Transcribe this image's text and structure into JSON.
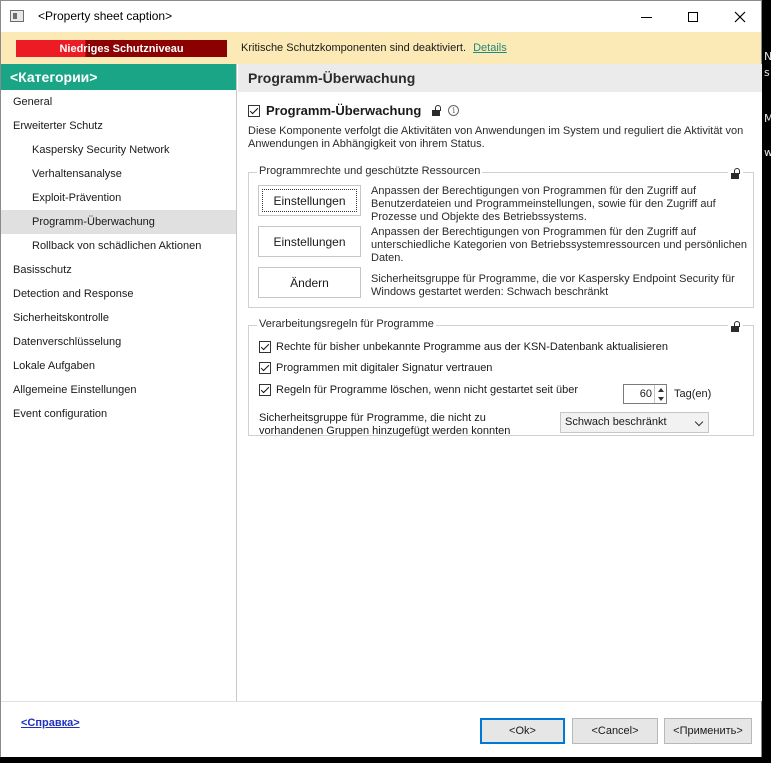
{
  "window": {
    "title": "<Property sheet caption>",
    "controls": {
      "minimize": "minimize",
      "maximize": "maximize",
      "close": "close"
    }
  },
  "alert": {
    "badge": "Niedriges Schutzniveau",
    "message": "Kritische Schutzkomponenten sind deaktiviert.",
    "link": "Details",
    "badge_colors": [
      "#ed1c24",
      "#8b0000"
    ],
    "background": "#fbeab5"
  },
  "sidebar": {
    "header": "<Категории>",
    "accent": "#1aa587",
    "items": [
      {
        "label": "General",
        "level": 0
      },
      {
        "label": "Erweiterter Schutz",
        "level": 0
      },
      {
        "label": "Kaspersky Security Network",
        "level": 1
      },
      {
        "label": "Verhaltensanalyse",
        "level": 1
      },
      {
        "label": "Exploit-Prävention",
        "level": 1
      },
      {
        "label": "Programm-Überwachung",
        "level": 1,
        "selected": true
      },
      {
        "label": "Rollback von schädlichen Aktionen",
        "level": 1
      },
      {
        "label": "Basisschutz",
        "level": 0
      },
      {
        "label": "Detection and Response",
        "level": 0
      },
      {
        "label": "Sicherheitskontrolle",
        "level": 0
      },
      {
        "label": "Datenverschlüsselung",
        "level": 0
      },
      {
        "label": "Lokale Aufgaben",
        "level": 0
      },
      {
        "label": "Allgemeine Einstellungen",
        "level": 0
      },
      {
        "label": "Event configuration",
        "level": 0
      }
    ]
  },
  "main": {
    "page_title": "Programm-Überwachung",
    "component_toggle": {
      "label": "Programm-Überwachung",
      "checked": true,
      "lock_icon": "lock-open-icon",
      "info_icon": "info-icon"
    },
    "description": "Diese Komponente verfolgt die Aktivitäten von Anwendungen im System und reguliert die Aktivität von Anwendungen in Abhängigkeit von ihrem Status.",
    "rights_group": {
      "title": "Programmrechte und geschützte Ressourcen",
      "rows": [
        {
          "button": "Einstellungen",
          "text": "Anpassen der Berechtigungen von Programmen für den Zugriff auf Benutzerdateien und Programmeinstellungen, sowie für den Zugriff auf Prozesse und Objekte des Betriebssystems."
        },
        {
          "button": "Einstellungen",
          "text": "Anpassen der Berechtigungen von Programmen für den Zugriff auf unterschiedliche Kategorien von Betriebssystemressourcen und persönlichen Daten."
        },
        {
          "button": "Ändern",
          "text": "Sicherheitsgruppe für Programme, die vor Kaspersky Endpoint Security für Windows gestartet werden: Schwach beschränkt"
        }
      ]
    },
    "rules_group": {
      "title": "Verarbeitungsregeln für Programme",
      "checks": [
        {
          "label": "Rechte für bisher unbekannte Programme aus der KSN-Datenbank aktualisieren",
          "checked": true
        },
        {
          "label": "Programmen mit digitaler Signatur vertrauen",
          "checked": true
        },
        {
          "label": "Regeln für Programme löschen, wenn nicht gestartet seit über",
          "checked": true
        }
      ],
      "days_value": "60",
      "days_unit": "Tag(en)",
      "security_group_label": "Sicherheitsgruppe für Programme, die nicht zu vorhandenen Gruppen hinzugefügt werden konnten",
      "security_group_value": "Schwach beschränkt"
    }
  },
  "footer": {
    "help": "<Справка>",
    "ok": "<Ok>",
    "cancel": "<Cancel>",
    "apply": "<Применить>"
  },
  "background_fragments": [
    "N",
    "s",
    "Ma",
    "wi"
  ]
}
